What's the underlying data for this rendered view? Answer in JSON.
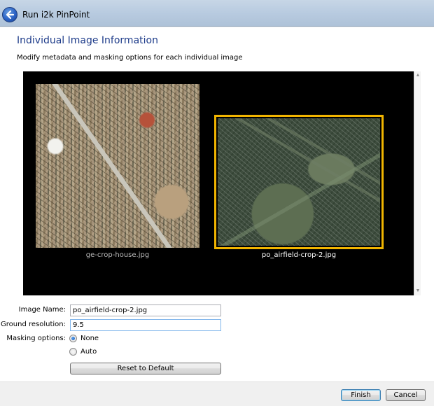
{
  "window": {
    "title": "Run i2k PinPoint"
  },
  "page": {
    "heading": "Individual Image Information",
    "subheading": "Modify metadata and masking options for each individual image"
  },
  "images": [
    {
      "name": "ge-crop-house.jpg",
      "selected": false
    },
    {
      "name": "po_airfield-crop-2.jpg",
      "selected": true
    }
  ],
  "form": {
    "image_name_label": "Image Name:",
    "image_name_value": "po_airfield-crop-2.jpg",
    "ground_resolution_label": "Ground resolution:",
    "ground_resolution_value": "9.5",
    "masking_label": "Masking options:",
    "masking_options": [
      "None",
      "Auto"
    ],
    "masking_selected": "None",
    "reset_label": "Reset to Default"
  },
  "footer": {
    "finish_label": "Finish",
    "cancel_label": "Cancel"
  },
  "colors": {
    "heading": "#1e3c8a",
    "selection_frame": "#f0b400",
    "viewer_bg": "#000000"
  }
}
